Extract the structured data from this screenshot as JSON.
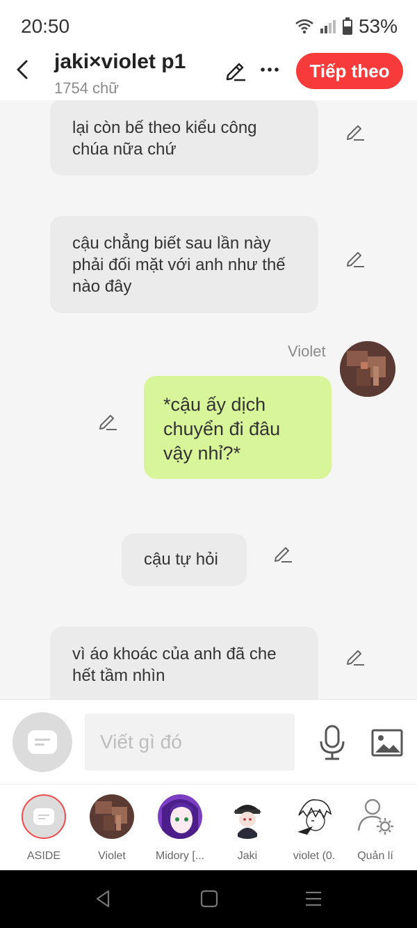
{
  "status": {
    "time": "20:50",
    "battery": "53%"
  },
  "header": {
    "title": "jaki×violet p1",
    "subtitle": "1754 chữ",
    "next_label": "Tiếp theo"
  },
  "messages": [
    {
      "text": "lại còn bế theo kiểu công chúa nữa chứ"
    },
    {
      "text": "cậu chẳng biết sau lần này phải đối mặt với anh như thế nào đây"
    },
    {
      "speaker": "Violet",
      "text": "*cậu ấy dịch chuyển đi đâu vậy nhỉ?*"
    },
    {
      "text": "cậu tự hỏi"
    },
    {
      "text": "vì áo khoác của anh đã che hết tầm nhìn"
    }
  ],
  "composer": {
    "placeholder": "Viết gì đó"
  },
  "characters": [
    {
      "label": "ASIDE"
    },
    {
      "label": "Violet"
    },
    {
      "label": "Midory [..."
    },
    {
      "label": "Jaki"
    },
    {
      "label": "violet (0."
    },
    {
      "label": "Quản lí"
    }
  ],
  "colors": {
    "accent": "#f73b3b",
    "my_bubble": "#d8f59a",
    "other_bubble": "#ebebeb",
    "chat_bg": "#f5f5f5"
  }
}
